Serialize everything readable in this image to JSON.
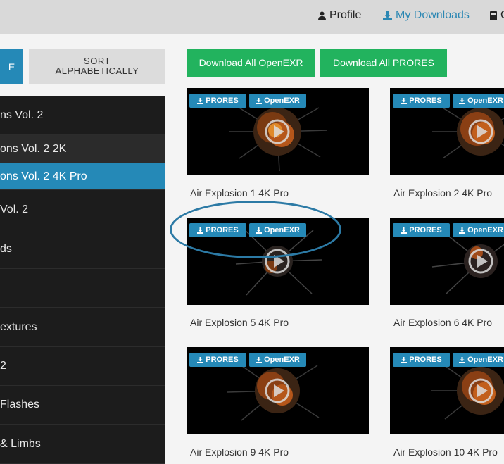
{
  "nav": {
    "profile_label": "Profile",
    "downloads_label": "My Downloads",
    "third_label": "C"
  },
  "toolbar": {
    "left_button_label": "E",
    "sort_line1": "SORT",
    "sort_line2": "ALPHABETICALLY"
  },
  "sidebar": {
    "items": [
      {
        "label": "ns Vol. 2",
        "state": "normal"
      },
      {
        "label": "ons Vol. 2 2K",
        "state": "sub"
      },
      {
        "label": "ons Vol. 2 4K Pro",
        "state": "active"
      },
      {
        "label": "Vol. 2",
        "state": "normal"
      },
      {
        "label": "ds",
        "state": "normal"
      },
      {
        "label": "",
        "state": "normal"
      },
      {
        "label": "extures",
        "state": "normal"
      },
      {
        "label": " 2",
        "state": "normal"
      },
      {
        "label": "Flashes",
        "state": "normal"
      },
      {
        "label": "& Limbs",
        "state": "normal"
      }
    ]
  },
  "downloads": {
    "exr_all_label": "Download All OpenEXR",
    "prores_all_label": "Download All PRORES"
  },
  "format_labels": {
    "prores": "PRORES",
    "exr": "OpenEXR"
  },
  "cards": [
    {
      "title": "Air Explosion 1 4K Pro"
    },
    {
      "title": "Air Explosion 2 4K Pro"
    },
    {
      "title": "Air Explosion 5 4K Pro"
    },
    {
      "title": "Air Explosion 6 4K Pro"
    },
    {
      "title": "Air Explosion 9 4K Pro"
    },
    {
      "title": "Air Explosion 10 4K Pro"
    }
  ],
  "colors": {
    "accent": "#2589b7",
    "download_green": "#22b35e",
    "sidebar_bg": "#1c1c1c",
    "annotation": "#2c7aa5"
  },
  "icons": {
    "profile": "user-icon",
    "downloads": "download-icon",
    "format": "download-icon",
    "thumbnail_play": "play-icon"
  }
}
